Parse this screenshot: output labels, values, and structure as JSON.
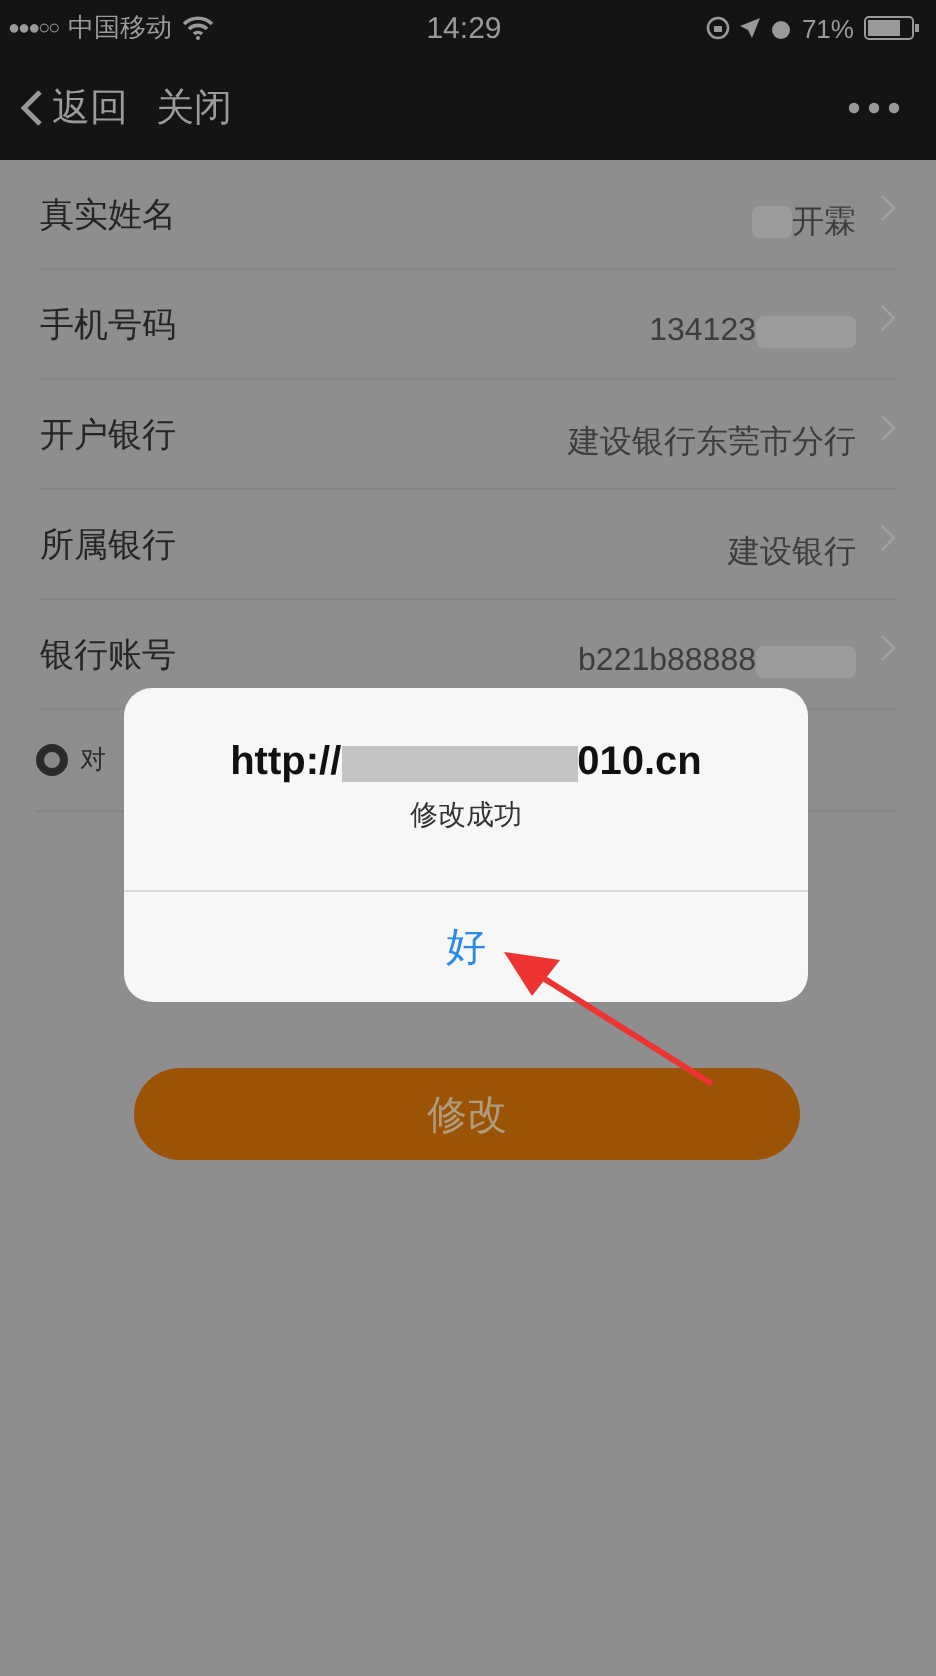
{
  "status_bar": {
    "signal": "●●●○○",
    "carrier": "中国移动",
    "time": "14:29",
    "battery_text": "71%"
  },
  "nav": {
    "back": "返回",
    "close": "关闭"
  },
  "form": {
    "rows": [
      {
        "label": "真实姓名",
        "value": "开霖",
        "blurred_start": true,
        "blurred_end": false
      },
      {
        "label": "手机号码",
        "value": "134123",
        "blurred_start": false,
        "blurred_end": true
      },
      {
        "label": "开户银行",
        "value": "建设银行东莞市分行",
        "blurred_start": false,
        "blurred_end": false
      },
      {
        "label": "所属银行",
        "value": "建设银行",
        "blurred_start": false,
        "blurred_end": false
      },
      {
        "label": "银行账号",
        "value": "b221b88888",
        "blurred_start": false,
        "blurred_end": true
      }
    ],
    "radio": {
      "label": "对",
      "selected": true
    }
  },
  "submit_button": "修改",
  "dialog": {
    "title_start": "http://",
    "title_end": "010.cn",
    "message": "修改成功",
    "button": "好"
  }
}
